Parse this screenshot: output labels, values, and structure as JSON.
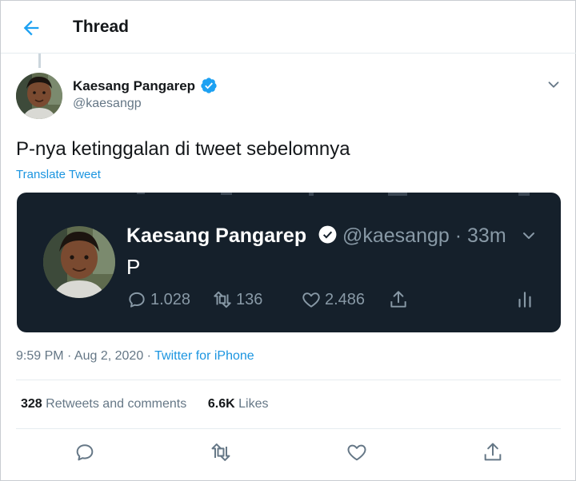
{
  "header": {
    "title": "Thread"
  },
  "tweet": {
    "author_name": "Kaesang Pangarep",
    "author_handle": "@kaesangp",
    "text": "P-nya ketinggalan di tweet sebelomnya",
    "translate_label": "Translate Tweet",
    "timestamp": "9:59 PM · Aug 2, 2020 · ",
    "source": "Twitter for iPhone"
  },
  "embedded": {
    "author_name": "Kaesang Pangarep",
    "handle_time": "@kaesangp · 33m",
    "text": "P",
    "replies": "1.028",
    "retweets": "136",
    "likes": "2.486"
  },
  "stats": {
    "retweets_count": "328",
    "retweets_label": "Retweets and comments",
    "likes_count": "6.6K",
    "likes_label": "Likes"
  },
  "colors": {
    "accent": "#1da1f2",
    "dark_background": "#15202b",
    "muted_text": "#657786"
  },
  "icons": [
    "back-arrow-icon",
    "verified-badge-icon",
    "chevron-down-icon",
    "reply-icon",
    "retweet-icon",
    "like-icon",
    "share-icon",
    "analytics-icon"
  ]
}
